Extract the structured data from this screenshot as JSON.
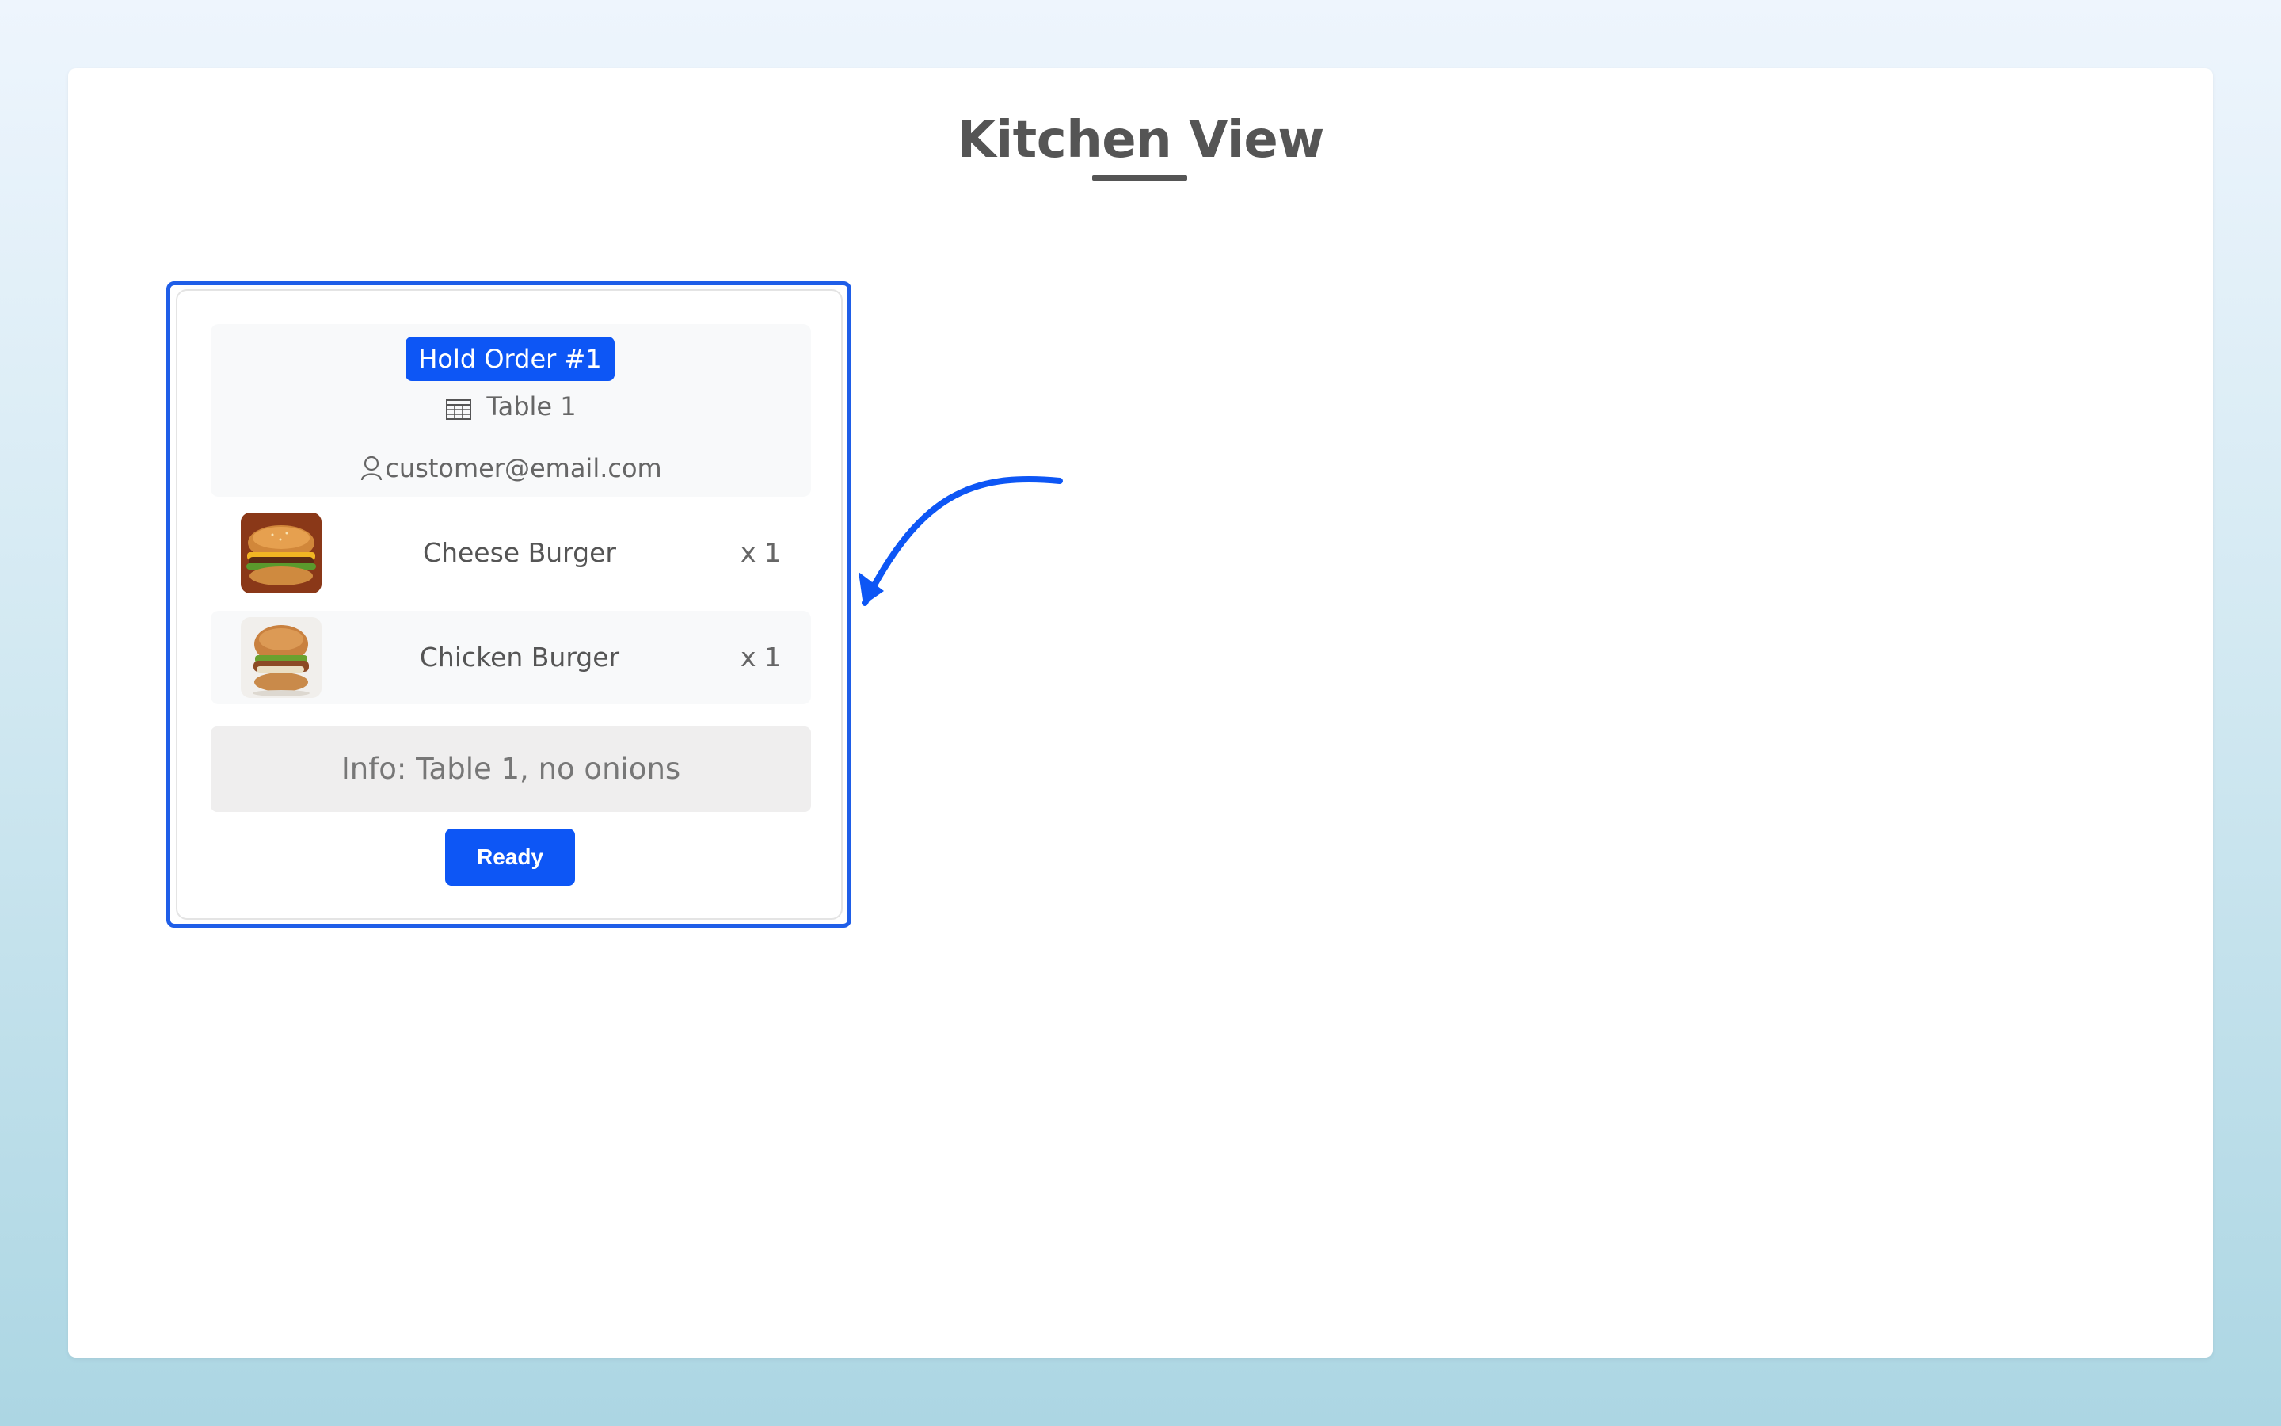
{
  "page": {
    "title": "Kitchen View"
  },
  "order": {
    "badge": "Hold Order #1",
    "table": "Table 1",
    "customer_email": "customer@email.com",
    "items": [
      {
        "name": "Cheese Burger",
        "quantity": "x 1"
      },
      {
        "name": "Chicken Burger",
        "quantity": "x 1"
      }
    ],
    "info": "Info: Table 1, no onions",
    "ready_label": "Ready"
  },
  "icons": {
    "table": "table-grid-icon",
    "customer": "user-icon",
    "annotation": "curved-arrow-icon"
  },
  "colors": {
    "accent": "#0d56f5",
    "highlight": "#1f5ee8",
    "text": "#555555"
  }
}
